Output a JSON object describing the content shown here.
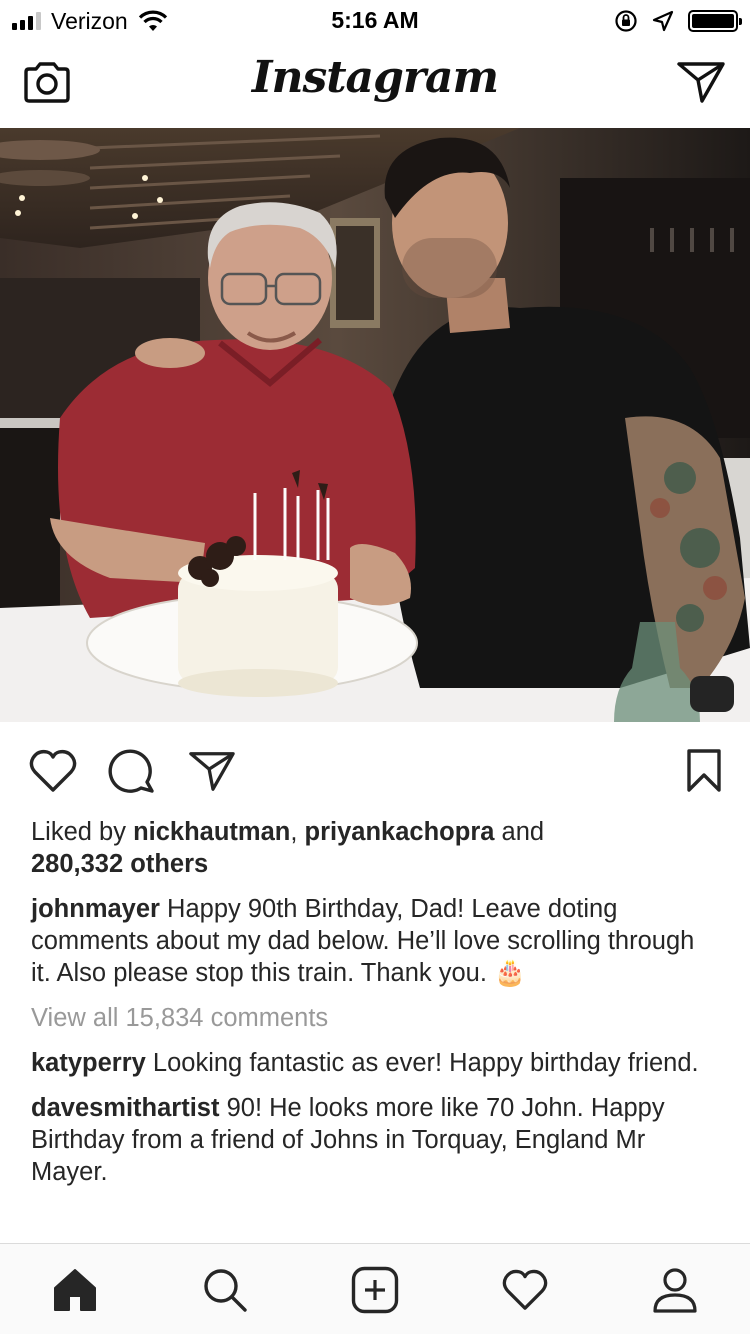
{
  "status_bar": {
    "carrier": "Verizon",
    "time": "5:16 AM",
    "signal_bars": 3,
    "battery_level": 1.0
  },
  "header": {
    "logo_text": "Instagram",
    "left_icon": "camera-icon",
    "right_icon": "direct-message-icon"
  },
  "post": {
    "likes": {
      "prefix": "Liked by ",
      "user1": "nickhautman",
      "separator": ", ",
      "user2": "priyankachopra",
      "and": " and",
      "others": "280,332 others"
    },
    "caption": {
      "username": "johnmayer",
      "text": " Happy 90th Birthday, Dad! Leave doting comments about my dad below. He’ll love scrolling through it. Also please stop this train. Thank you. 🎂"
    },
    "view_all": "View all 15,834 comments",
    "comments": [
      {
        "username": "katyperry",
        "text": " Looking fantastic as ever! Happy birthday friend."
      },
      {
        "username": "davesmithartist",
        "text": " 90! He looks more like 70 John. Happy Birthday from a friend of Johns in Torquay, England Mr Mayer."
      }
    ]
  },
  "actions": [
    "heart-icon",
    "comment-icon",
    "share-icon",
    "bookmark-icon"
  ],
  "tab_bar": [
    "home-icon",
    "search-icon",
    "new-post-icon",
    "activity-icon",
    "profile-icon"
  ],
  "colors": {
    "text": "#262626",
    "muted": "#999999",
    "border": "#dbdbdb",
    "shirt_red": "#9c2c34"
  }
}
